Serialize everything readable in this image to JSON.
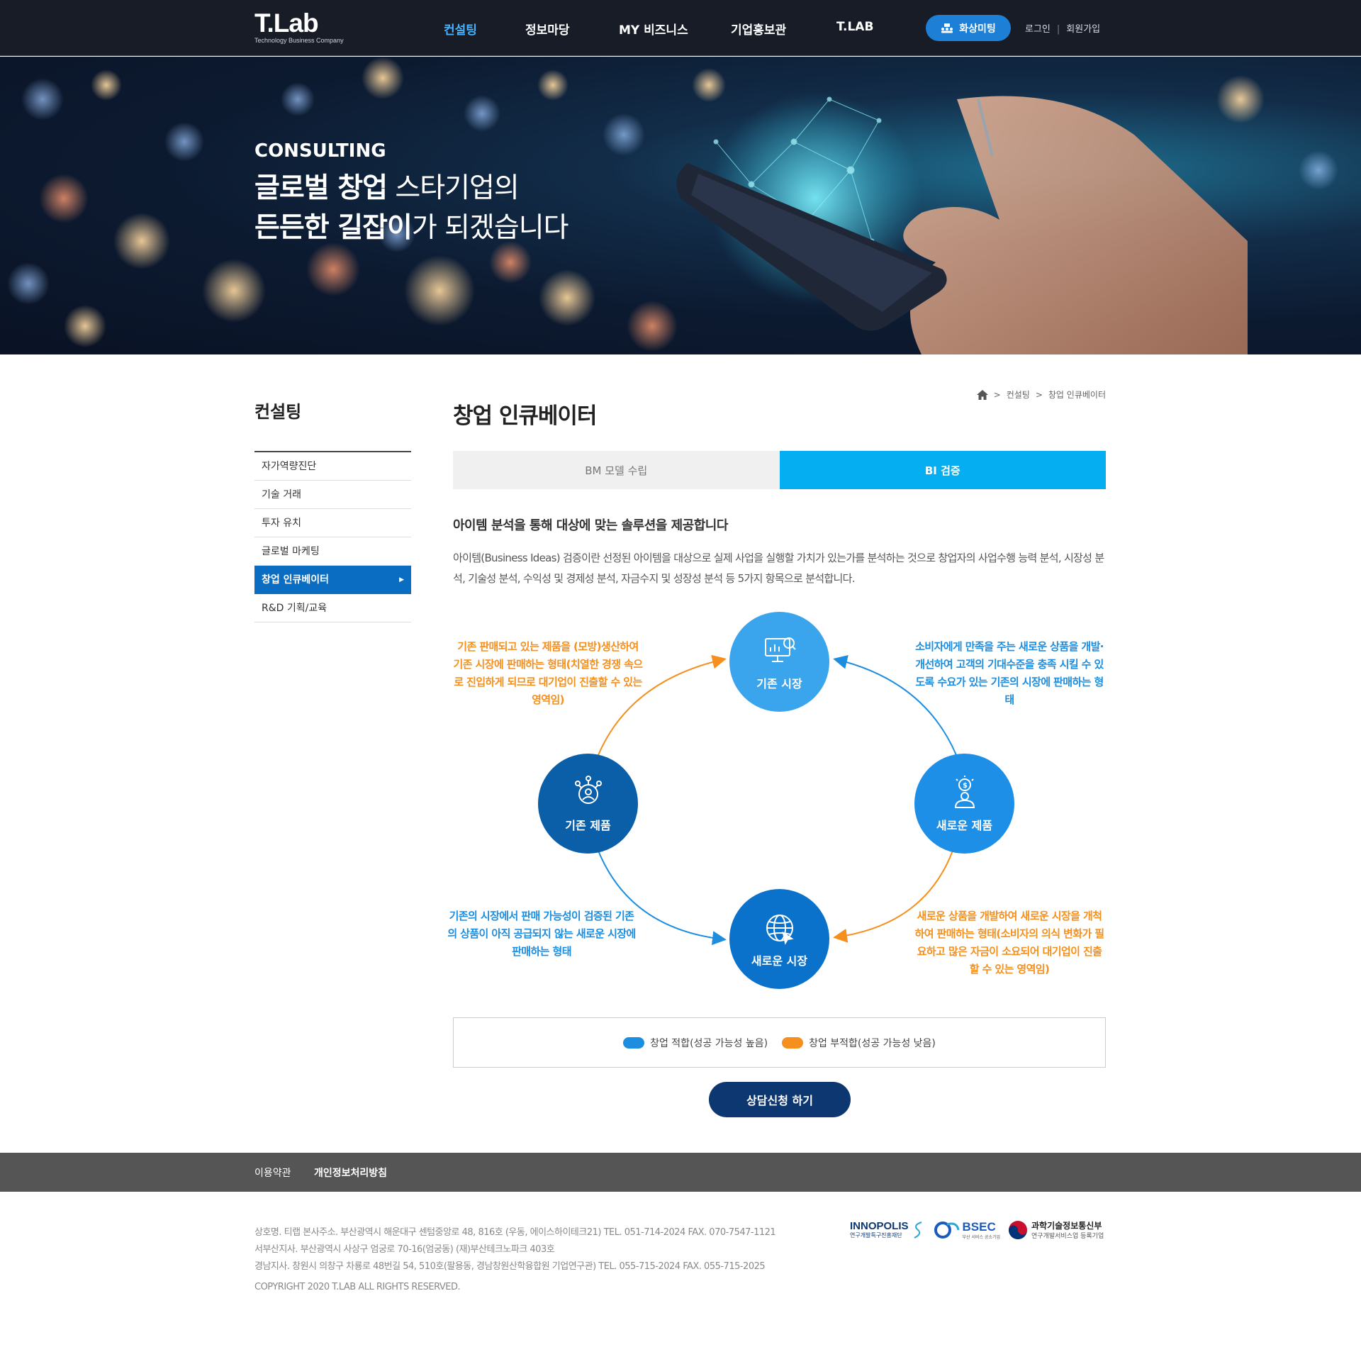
{
  "header": {
    "logo": {
      "main": "T.Lab",
      "sub": "Technology Business Company"
    },
    "nav": [
      "컨설팅",
      "정보마당",
      "MY 비즈니스",
      "기업홍보관",
      "T.LAB"
    ],
    "meeting_label": "화상미팅",
    "login": "로그인",
    "signup": "회원가입",
    "accent": "#47b3ff"
  },
  "hero": {
    "eyebrow": "CONSULTING",
    "line1_bold": "글로벌 창업",
    "line1_rest": " 스타기업의",
    "line2_bold": "든든한 길잡이",
    "line2_rest": "가 되겠습니다"
  },
  "sidebar": {
    "title": "컨설팅",
    "items": [
      {
        "label": "자가역량진단"
      },
      {
        "label": "기술 거래"
      },
      {
        "label": "투자 유치"
      },
      {
        "label": "글로벌 마케팅"
      },
      {
        "label": "창업 인큐베이터",
        "active": true
      },
      {
        "label": "R&D 기획/교육"
      }
    ]
  },
  "breadcrumb": {
    "items": [
      "컨설팅",
      "창업 인큐베이터"
    ],
    "sep": ">"
  },
  "page": {
    "title": "창업 인큐베이터",
    "tabs": [
      {
        "label": "BM 모델 수립"
      },
      {
        "label": "BI 검증",
        "active": true
      }
    ],
    "lead": "아이템 분석을 통해 대상에 맞는 솔루션을 제공합니다",
    "desc": "아이템(Business Ideas) 검증이란 선정된 아이템을 대상으로 실제 사업을 실행할 가치가 있는가를 분석하는 것으로 창업자의 사업수행 능력 분석, 시장성 분석, 기술성 분석, 수익성 및 경제성 분석, 자금수지 및 성장성 분석 등 5가지 항목으로 분석합니다."
  },
  "diagram": {
    "nodes": {
      "top": "기존 시장",
      "left": "기존 제품",
      "right": "새로운 제품",
      "bottom": "새로운 시장"
    },
    "notes": {
      "top_left": "기존 판매되고 있는 제품을 (모방)생산하여 기존 시장에 판매하는 형태(치열한 경쟁 속으로 진입하게 되므로 대기업이 진출할 수 있는 영역임)",
      "top_right": "소비자에게 만족을 주는 새로운 상품을 개발·개선하여 고객의 기대수준을 충족 시킬 수 있도록 수요가 있는 기존의 시장에 판매하는 형태",
      "bottom_left": "기존의 시장에서 판매 가능성이 검증된 기존의 상품이 아직 공급되지 않는 새로운 시장에 판매하는 형태",
      "bottom_right": "새로운 상품을 개발하여 새로운 시장을 개척하여 판매하는 형태(소비자의 의식 변화가 필요하고 많은 자금이 소요되어 대기업이 진출할 수 있는 영역임)"
    },
    "colors": {
      "blue": "#1d8de0",
      "orange": "#f5901e",
      "light_blue": "#3aa5ec",
      "navy": "#0a5fa8",
      "mid_blue": "#1e8fe6",
      "dark_blue": "#0b72cc"
    }
  },
  "legend": {
    "items": [
      {
        "label": "창업 적합(성공 가능성 높음)",
        "color": "#1d8de0"
      },
      {
        "label": "창업 부적합(성공 가능성 낮음)",
        "color": "#f5901e"
      }
    ]
  },
  "cta": {
    "label": "상담신청 하기"
  },
  "footer": {
    "links": [
      "이용약관",
      "개인정보처리방침"
    ],
    "info": [
      "상호명. 티랩   본사주소. 부산광역시 해운대구 센텀중앙로 48, 816호 (우동, 에이스하이테크21)   TEL. 051-714-2024   FAX. 070-7547-1121",
      "서부산지사. 부산광역시 사상구 엄궁로 70-16(엄궁동) (재)부산테크노파크 403호",
      "경남지사. 창원시 의창구 차룡로 48번길 54, 510호(팔용동, 경남창원산학융합원 기업연구관)  TEL. 055-715-2024   FAX. 055-715-2025"
    ],
    "copyright": "COPYRIGHT 2020 T.LAB ALL RIGHTS RESERVED.",
    "partners": {
      "inno": {
        "name": "INNOPOLIS",
        "sub": "연구개발특구진흥재단"
      },
      "bsec": {
        "name": "BSEC",
        "sub": "부산 서비스 공소기업"
      },
      "msit": {
        "name": "과학기술정보통신부",
        "sub": "연구개발서비스업 등록기업"
      }
    }
  }
}
